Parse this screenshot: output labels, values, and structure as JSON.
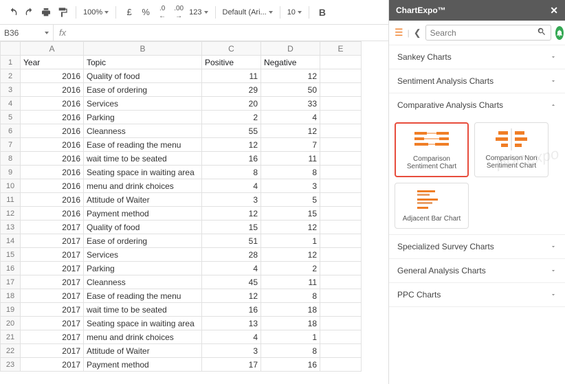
{
  "toolbar": {
    "zoom": "100%",
    "currency": "£",
    "percent": "%",
    "dec_dec": ".0",
    "dec_inc": ".00",
    "number_format": "123",
    "font": "Default (Ari...",
    "font_size": "10",
    "bold": "B"
  },
  "namebox": "B36",
  "columns": [
    "A",
    "B",
    "C",
    "D",
    "E"
  ],
  "headers": {
    "A": "Year",
    "B": "Topic",
    "C": "Positive",
    "D": "Negative"
  },
  "rows": [
    {
      "n": 1
    },
    {
      "n": 2,
      "A": "2016",
      "B": "Quality of food",
      "C": "11",
      "D": "12"
    },
    {
      "n": 3,
      "A": "2016",
      "B": "Ease of ordering",
      "C": "29",
      "D": "50"
    },
    {
      "n": 4,
      "A": "2016",
      "B": "Services",
      "C": "20",
      "D": "33"
    },
    {
      "n": 5,
      "A": "2016",
      "B": "Parking",
      "C": "2",
      "D": "4"
    },
    {
      "n": 6,
      "A": "2016",
      "B": "Cleanness",
      "C": "55",
      "D": "12"
    },
    {
      "n": 7,
      "A": "2016",
      "B": "Ease of reading the menu",
      "C": "12",
      "D": "7"
    },
    {
      "n": 8,
      "A": "2016",
      "B": "wait time to be seated",
      "C": "16",
      "D": "11"
    },
    {
      "n": 9,
      "A": "2016",
      "B": "Seating space in waiting area",
      "C": "8",
      "D": "8"
    },
    {
      "n": 10,
      "A": "2016",
      "B": "menu and drink choices",
      "C": "4",
      "D": "3"
    },
    {
      "n": 11,
      "A": "2016",
      "B": "Attitude of Waiter",
      "C": "3",
      "D": "5"
    },
    {
      "n": 12,
      "A": "2016",
      "B": "Payment method",
      "C": "12",
      "D": "15"
    },
    {
      "n": 13,
      "A": "2017",
      "B": "Quality of food",
      "C": "15",
      "D": "12"
    },
    {
      "n": 14,
      "A": "2017",
      "B": "Ease of ordering",
      "C": "51",
      "D": "1"
    },
    {
      "n": 15,
      "A": "2017",
      "B": "Services",
      "C": "28",
      "D": "12"
    },
    {
      "n": 16,
      "A": "2017",
      "B": "Parking",
      "C": "4",
      "D": "2"
    },
    {
      "n": 17,
      "A": "2017",
      "B": "Cleanness",
      "C": "45",
      "D": "11"
    },
    {
      "n": 18,
      "A": "2017",
      "B": "Ease of reading the menu",
      "C": "12",
      "D": "8"
    },
    {
      "n": 19,
      "A": "2017",
      "B": "wait time to be seated",
      "C": "16",
      "D": "18"
    },
    {
      "n": 20,
      "A": "2017",
      "B": "Seating space in waiting area",
      "C": "13",
      "D": "18"
    },
    {
      "n": 21,
      "A": "2017",
      "B": "menu and drink choices",
      "C": "4",
      "D": "1"
    },
    {
      "n": 22,
      "A": "2017",
      "B": "Attitude of Waiter",
      "C": "3",
      "D": "8"
    },
    {
      "n": 23,
      "A": "2017",
      "B": "Payment method",
      "C": "17",
      "D": "16"
    }
  ],
  "sidebar": {
    "title": "ChartExpo™",
    "search_placeholder": "Search",
    "categories": [
      {
        "label": "Sankey Charts",
        "open": false
      },
      {
        "label": "Sentiment Analysis Charts",
        "open": false
      },
      {
        "label": "Comparative Analysis Charts",
        "open": true
      },
      {
        "label": "Specialized Survey Charts",
        "open": false
      },
      {
        "label": "General Analysis Charts",
        "open": false
      },
      {
        "label": "PPC Charts",
        "open": false
      }
    ],
    "charts": [
      {
        "label": "Comparison Sentiment Chart",
        "selected": true
      },
      {
        "label": "Comparison Non Sentiment Chart",
        "selected": false
      },
      {
        "label": "Adjacent Bar Chart",
        "selected": false
      }
    ],
    "watermark": "PPCexpo"
  }
}
